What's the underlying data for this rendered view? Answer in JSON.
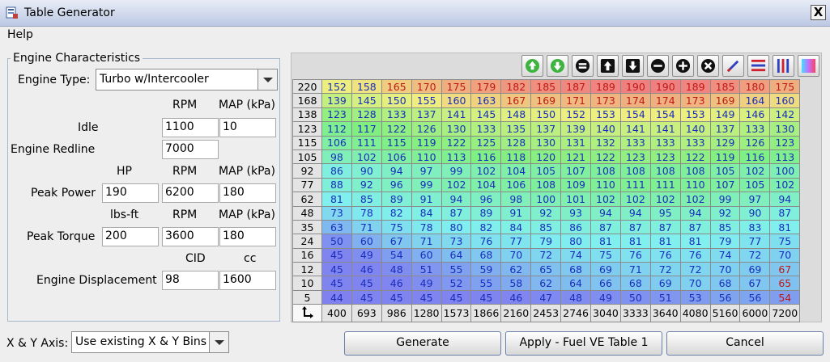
{
  "window": {
    "title": "Table Generator",
    "close_glyph": "X"
  },
  "menu": {
    "help_label": "Help"
  },
  "engine": {
    "group_title": "Engine Characteristics",
    "type_label": "Engine Type:",
    "type_value": "Turbo w/Intercooler",
    "col_rpm": "RPM",
    "col_map": "MAP (kPa)",
    "idle_label": "Idle",
    "idle_rpm": "1100",
    "idle_map": "10",
    "redline_label": "Engine Redline",
    "redline_rpm": "7000",
    "col_hp": "HP",
    "power_label": "Peak Power",
    "power_hp": "190",
    "power_rpm": "6200",
    "power_map": "180",
    "col_lbsft": "lbs-ft",
    "torque_label": "Peak Torque",
    "torque_lbsft": "200",
    "torque_rpm": "3600",
    "torque_map": "180",
    "col_cid": "CID",
    "col_cc": "cc",
    "displacement_label": "Engine Displacement",
    "disp_cid": "98",
    "disp_cc": "1600"
  },
  "toolbar_icons": [
    "green-up-circle-icon",
    "green-down-circle-icon",
    "equals-icon",
    "increment-up-icon",
    "increment-down-icon",
    "minus-icon",
    "plus-icon",
    "multiply-icon",
    "pen-icon",
    "row-lines-icon",
    "column-lines-icon",
    "color-gradient-icon"
  ],
  "table": {
    "y_bins": [
      "220",
      "168",
      "138",
      "123",
      "115",
      "105",
      "92",
      "77",
      "62",
      "48",
      "35",
      "24",
      "16",
      "12",
      "10",
      "5"
    ],
    "x_bins": [
      "400",
      "693",
      "986",
      "1280",
      "1573",
      "1866",
      "2160",
      "2453",
      "2746",
      "3040",
      "3333",
      "3640",
      "4080",
      "5160",
      "6000",
      "7200"
    ],
    "rows": [
      [
        "152",
        "158",
        "165",
        "170",
        "175",
        "179",
        "182",
        "185",
        "187",
        "189",
        "190",
        "190",
        "189",
        "185",
        "180",
        "175"
      ],
      [
        "139",
        "145",
        "150",
        "155",
        "160",
        "163",
        "167",
        "169",
        "171",
        "173",
        "174",
        "174",
        "173",
        "169",
        "164",
        "160"
      ],
      [
        "123",
        "128",
        "133",
        "137",
        "141",
        "145",
        "148",
        "150",
        "152",
        "153",
        "154",
        "154",
        "153",
        "149",
        "146",
        "142"
      ],
      [
        "112",
        "117",
        "122",
        "126",
        "130",
        "133",
        "135",
        "137",
        "139",
        "140",
        "141",
        "141",
        "140",
        "137",
        "133",
        "130"
      ],
      [
        "106",
        "111",
        "115",
        "119",
        "122",
        "125",
        "128",
        "130",
        "131",
        "132",
        "133",
        "133",
        "133",
        "129",
        "126",
        "123"
      ],
      [
        "98",
        "102",
        "106",
        "110",
        "113",
        "116",
        "118",
        "120",
        "121",
        "122",
        "123",
        "123",
        "122",
        "119",
        "116",
        "113"
      ],
      [
        "86",
        "90",
        "94",
        "97",
        "99",
        "102",
        "104",
        "105",
        "107",
        "108",
        "108",
        "108",
        "108",
        "105",
        "102",
        "100"
      ],
      [
        "88",
        "92",
        "96",
        "99",
        "102",
        "104",
        "106",
        "108",
        "109",
        "110",
        "111",
        "111",
        "110",
        "107",
        "105",
        "102"
      ],
      [
        "81",
        "85",
        "89",
        "91",
        "94",
        "96",
        "98",
        "100",
        "101",
        "102",
        "102",
        "102",
        "102",
        "99",
        "97",
        "94"
      ],
      [
        "73",
        "78",
        "82",
        "84",
        "87",
        "89",
        "91",
        "92",
        "93",
        "94",
        "94",
        "95",
        "94",
        "92",
        "90",
        "87"
      ],
      [
        "63",
        "71",
        "75",
        "78",
        "80",
        "82",
        "84",
        "85",
        "86",
        "87",
        "87",
        "87",
        "87",
        "85",
        "83",
        "81"
      ],
      [
        "50",
        "60",
        "67",
        "71",
        "73",
        "76",
        "77",
        "79",
        "80",
        "81",
        "81",
        "81",
        "81",
        "79",
        "77",
        "75"
      ],
      [
        "45",
        "49",
        "54",
        "60",
        "64",
        "68",
        "70",
        "72",
        "74",
        "75",
        "76",
        "76",
        "76",
        "74",
        "72",
        "70"
      ],
      [
        "45",
        "46",
        "48",
        "51",
        "55",
        "59",
        "62",
        "65",
        "68",
        "69",
        "71",
        "72",
        "72",
        "70",
        "69",
        "67"
      ],
      [
        "45",
        "45",
        "46",
        "49",
        "52",
        "55",
        "58",
        "62",
        "64",
        "66",
        "68",
        "69",
        "70",
        "68",
        "67",
        "65"
      ],
      [
        "44",
        "45",
        "45",
        "45",
        "45",
        "45",
        "46",
        "47",
        "48",
        "49",
        "50",
        "51",
        "53",
        "56",
        "56",
        "54"
      ]
    ]
  },
  "axis": {
    "label": "X & Y Axis:",
    "value": "Use existing X & Y Bins"
  },
  "buttons": {
    "generate": "Generate",
    "apply": "Apply - Fuel VE Table 1",
    "cancel": "Cancel"
  }
}
